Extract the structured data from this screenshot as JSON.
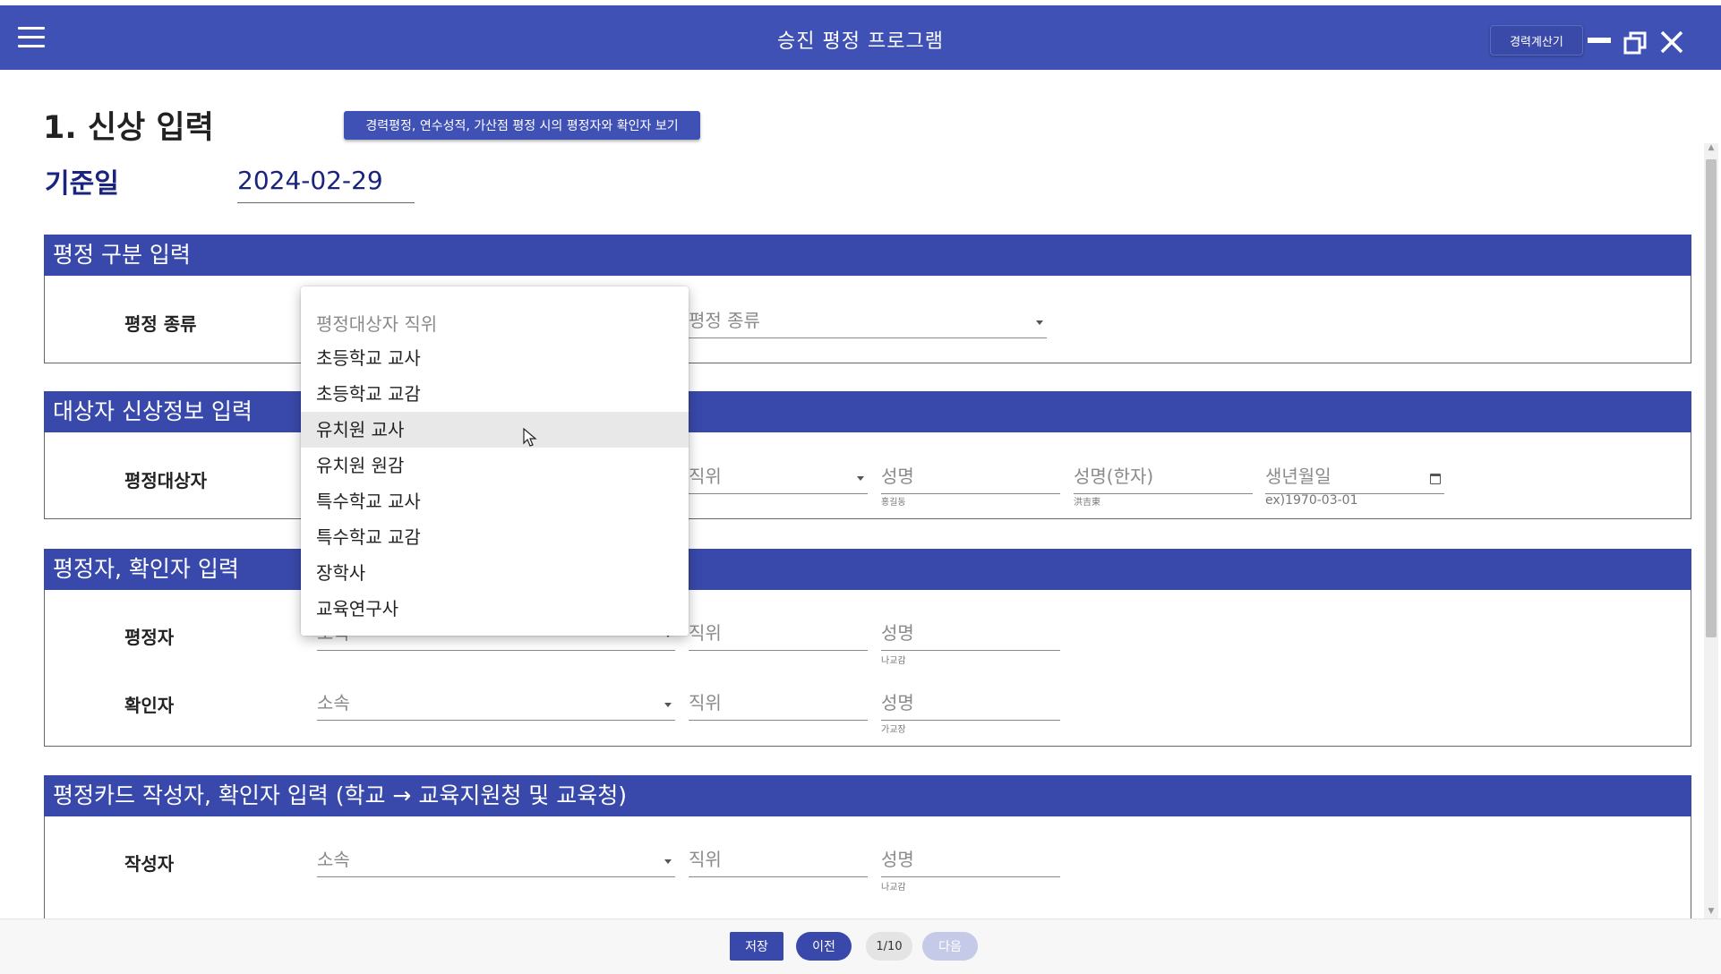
{
  "app": {
    "title": "승진 평정 프로그램",
    "calc_button": "경력계산기",
    "accent": "#3f51b5"
  },
  "page": {
    "title": "1. 신상 입력",
    "evaluator_button": "경력평정, 연수성적, 가산점 평정 시의 평정자와 확인자 보기",
    "base_date_label": "기준일",
    "base_date_value": "2024-02-29"
  },
  "sections": {
    "evaluation_type": {
      "header": "평정 구분 입력",
      "row_label": "평정 종류",
      "type_placeholder": "평정 종류"
    },
    "subject_info": {
      "header": "대상자 신상정보 입력",
      "row_label": "평정대상자",
      "position_placeholder": "직위",
      "name_placeholder": "성명",
      "name_hint": "홍길동",
      "hanja_placeholder": "성명(한자)",
      "hanja_hint": "洪吉東",
      "birth_placeholder": "생년월일",
      "birth_hint": "ex)1970-03-01"
    },
    "evaluator": {
      "header": "평정자, 확인자 입력",
      "evaluator_label": "평정자",
      "evaluator_affiliation": "소속",
      "evaluator_position": "직위",
      "evaluator_name": "성명",
      "evaluator_name_hint": "나교감",
      "confirmer_label": "확인자",
      "confirmer_affiliation": "소속",
      "confirmer_position": "직위",
      "confirmer_name": "성명",
      "confirmer_name_hint": "가교장"
    },
    "card_writer": {
      "header": "평정카드 작성자, 확인자 입력 (학교 → 교육지원청 및 교육청)",
      "writer_label": "작성자",
      "writer_affiliation": "소속",
      "writer_position": "직위",
      "writer_name": "성명",
      "writer_name_hint": "나교감"
    }
  },
  "dropdown": {
    "header": "평정대상자 직위",
    "items": [
      "초등학교 교사",
      "초등학교 교감",
      "유치원 교사",
      "유치원 원감",
      "특수학교 교사",
      "특수학교 교감",
      "장학사",
      "교육연구사"
    ],
    "hovered": "유치원 교사"
  },
  "footer": {
    "save": "저장",
    "prev": "이전",
    "page": "1/10",
    "next": "다음"
  }
}
